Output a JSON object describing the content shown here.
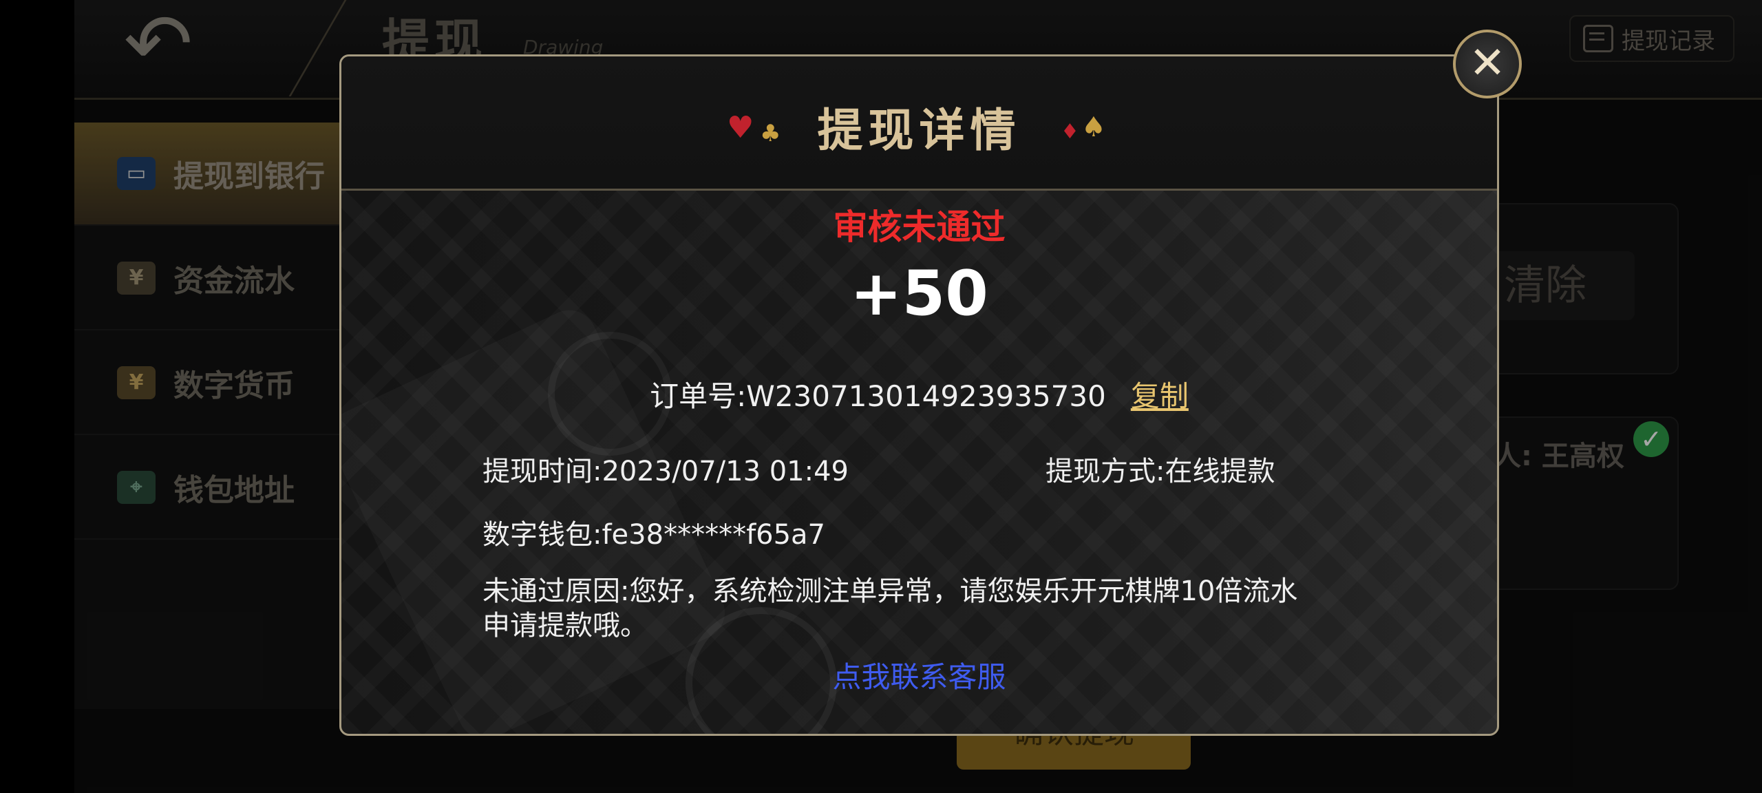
{
  "header": {
    "title": "提现",
    "subtitle": "Drawing",
    "record_button": "提现记录"
  },
  "sidebar": {
    "items": [
      {
        "label": "提现到银行",
        "active": true
      },
      {
        "label": "资金流水",
        "active": false
      },
      {
        "label": "数字货币",
        "active": false
      },
      {
        "label": "钱包地址",
        "active": false
      }
    ]
  },
  "background": {
    "clear_button": "清除",
    "payee_text": "人: 王高权",
    "submit_button": "确认提现"
  },
  "modal": {
    "title": "提现详情",
    "status": "审核未通过",
    "status_color": "#ee2b2b",
    "amount": "+50",
    "order": "订单号:W230713014923935730",
    "copy_label": "复制",
    "time": "提现时间:2023/07/13 01:49",
    "method": "提现方式:在线提款",
    "wallet": "数字钱包:fe38******f65a7",
    "reason_line1": "未通过原因:您好，系统检测注单异常，请您娱乐开元棋牌10倍流水",
    "reason_line2": "申请提款哦。",
    "contact_link": "点我联系客服",
    "contact_color": "#3f5cf0"
  },
  "icons": {
    "back": "back-arrow-icon",
    "close": "close-icon",
    "record": "document-icon",
    "check": "check-icon"
  }
}
